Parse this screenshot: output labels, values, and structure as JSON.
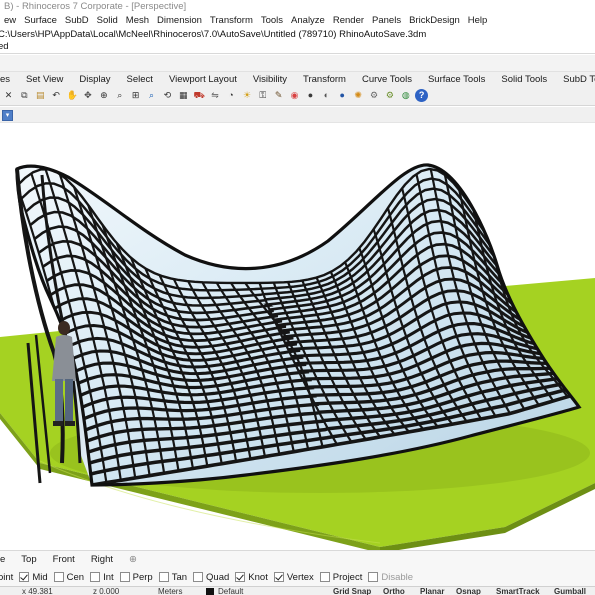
{
  "window": {
    "title": "B) - Rhinoceros 7 Corporate - [Perspective]"
  },
  "menubar": {
    "items": [
      "ew",
      "Surface",
      "SubD",
      "Solid",
      "Mesh",
      "Dimension",
      "Transform",
      "Tools",
      "Analyze",
      "Render",
      "Panels",
      "BrickDesign",
      "Help"
    ]
  },
  "command": {
    "line1": "C:\\Users\\HP\\AppData\\Local\\McNeel\\Rhinoceros\\7.0\\AutoSave\\Untitled (789710) RhinoAutoSave.3dm",
    "line2": "ed"
  },
  "toolbar_tabs": [
    "es",
    "Set View",
    "Display",
    "Select",
    "Viewport Layout",
    "Visibility",
    "Transform",
    "Curve Tools",
    "Surface Tools",
    "Solid Tools",
    "SubD Tools"
  ],
  "toolbar_icons": [
    {
      "name": "close-icon",
      "glyph": "✕",
      "color": "#333333"
    },
    {
      "name": "copy-icon",
      "glyph": "⧉",
      "color": "#444444"
    },
    {
      "name": "paste-icon",
      "glyph": "▤",
      "color": "#b88a2e"
    },
    {
      "name": "undo-icon",
      "glyph": "↶",
      "color": "#333333"
    },
    {
      "name": "pan-icon",
      "glyph": "✋",
      "color": "#555555"
    },
    {
      "name": "move-view-icon",
      "glyph": "✥",
      "color": "#444444"
    },
    {
      "name": "zoom-icon",
      "glyph": "⊕",
      "color": "#333333"
    },
    {
      "name": "zoom-window-icon",
      "glyph": "⌕",
      "color": "#333333"
    },
    {
      "name": "zoom-extents-icon",
      "glyph": "⊞",
      "color": "#333333"
    },
    {
      "name": "zoom-selected-icon",
      "glyph": "⌕",
      "color": "#1a5fb4"
    },
    {
      "name": "rotate-view-icon",
      "glyph": "⟲",
      "color": "#333333"
    },
    {
      "name": "grid-icon",
      "glyph": "▦",
      "color": "#333333"
    },
    {
      "name": "car-icon",
      "glyph": "⛟",
      "color": "#c0392b"
    },
    {
      "name": "layer-icon",
      "glyph": "⇋",
      "color": "#555555"
    },
    {
      "name": "clock-icon",
      "glyph": "◔",
      "color": "#333333"
    },
    {
      "name": "light-icon",
      "glyph": "☀",
      "color": "#d4a017"
    },
    {
      "name": "lock-icon",
      "glyph": "⚿",
      "color": "#333333"
    },
    {
      "name": "properties-icon",
      "glyph": "✎",
      "color": "#6b4f2a"
    },
    {
      "name": "color-wheel-icon",
      "glyph": "◉",
      "color": "#d94141"
    },
    {
      "name": "sphere-icon",
      "glyph": "●",
      "color": "#3a3a3a"
    },
    {
      "name": "render-sphere-icon",
      "glyph": "◐",
      "color": "#555555"
    },
    {
      "name": "material-icon",
      "glyph": "●",
      "color": "#2355a5"
    },
    {
      "name": "sun-icon",
      "glyph": "✺",
      "color": "#d48b17"
    },
    {
      "name": "gear-icon",
      "glyph": "⚙",
      "color": "#666666"
    },
    {
      "name": "options-icon",
      "glyph": "⚙",
      "color": "#6a8f2a"
    },
    {
      "name": "environment-icon",
      "glyph": "◍",
      "color": "#2e8a3a"
    },
    {
      "name": "help-icon",
      "glyph": "?",
      "color": "#ffffff",
      "bg": "#2d62c4"
    }
  ],
  "viewport": {
    "name": "Perspective",
    "ground_color": "#a6d225",
    "glass_color": "#d6e8f2",
    "mullion_color": "#141414"
  },
  "view_tabs": [
    "e",
    "Top",
    "Front",
    "Right",
    "⊕"
  ],
  "osnaps": [
    {
      "label": "oint",
      "checked": null,
      "enabled": true
    },
    {
      "label": "Mid",
      "checked": true,
      "enabled": true
    },
    {
      "label": "Cen",
      "checked": false,
      "enabled": true
    },
    {
      "label": "Int",
      "checked": false,
      "enabled": true
    },
    {
      "label": "Perp",
      "checked": false,
      "enabled": true
    },
    {
      "label": "Tan",
      "checked": false,
      "enabled": true
    },
    {
      "label": "Quad",
      "checked": false,
      "enabled": true
    },
    {
      "label": "Knot",
      "checked": true,
      "enabled": true
    },
    {
      "label": "Vertex",
      "checked": true,
      "enabled": true
    },
    {
      "label": "Project",
      "checked": false,
      "enabled": true
    },
    {
      "label": "Disable",
      "checked": false,
      "enabled": false
    }
  ],
  "status": {
    "x": "x 49.381",
    "z": "z 0.000",
    "units": "Meters",
    "layer": "Default",
    "panes": [
      "Grid Snap",
      "Ortho",
      "Planar",
      "Osnap",
      "SmartTrack",
      "Gumball"
    ]
  }
}
